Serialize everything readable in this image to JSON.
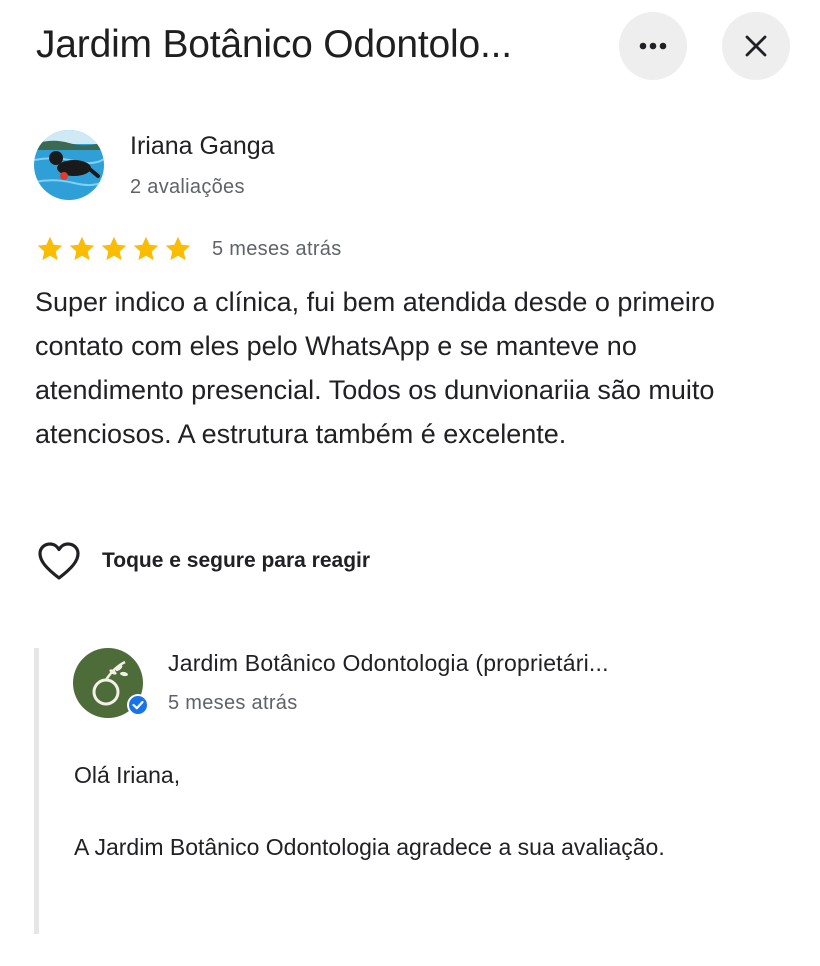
{
  "header": {
    "title": "Jardim Botânico Odontolo...",
    "more_icon": "more-horizontal-icon",
    "close_icon": "close-icon"
  },
  "review": {
    "author_name": "Iriana Ganga",
    "author_reviews": "2 avaliações",
    "rating": 5,
    "rating_max": 5,
    "date": "5 meses atrás",
    "text": "Super indico a clínica, fui bem atendida desde o primeiro contato com eles pelo WhatsApp e se manteve no atendimento presencial. Todos os dunvionariia são muito atenciosos. A estrutura também é excelente.",
    "react_label": "Toque e segure para reagir"
  },
  "owner_reply": {
    "name": "Jardim Botânico Odontologia (proprietári...",
    "date": "5 meses atrás",
    "greeting": "Olá Iriana,",
    "body": "A Jardim Botânico Odontologia agradece a sua avaliação."
  },
  "colors": {
    "star": "#fbbc04",
    "owner_avatar_bg": "#4e6b3a",
    "verified_badge": "#1a73e8",
    "button_bg": "#eeeeee"
  }
}
